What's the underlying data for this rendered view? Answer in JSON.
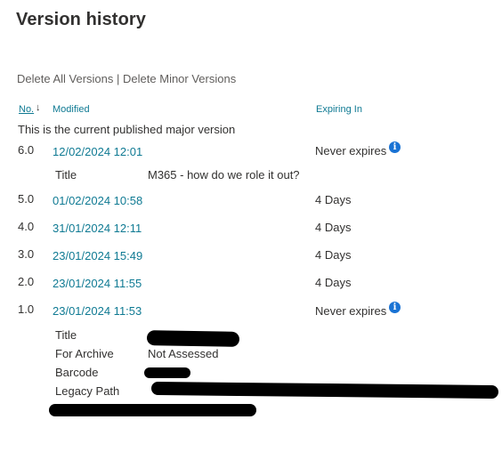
{
  "page": {
    "title": "Version history"
  },
  "actions": {
    "delete_all": "Delete All Versions",
    "separator": "|",
    "delete_minor": "Delete Minor Versions"
  },
  "columns": {
    "no": "No.",
    "sort_indicator": "↓",
    "modified": "Modified",
    "expiring": "Expiring In"
  },
  "current_note": "This is the current published major version",
  "versions": [
    {
      "no": "6.0",
      "modified": "12/02/2024 12:01",
      "expiring": "Never expires",
      "info_icon": "info-icon",
      "props": [
        {
          "label": "Title",
          "value": "M365 - how do we role it out?"
        }
      ]
    },
    {
      "no": "5.0",
      "modified": "01/02/2024 10:58",
      "expiring": "4 Days"
    },
    {
      "no": "4.0",
      "modified": "31/01/2024 12:11",
      "expiring": "4 Days"
    },
    {
      "no": "3.0",
      "modified": "23/01/2024 15:49",
      "expiring": "4 Days"
    },
    {
      "no": "2.0",
      "modified": "23/01/2024 11:55",
      "expiring": "4 Days"
    },
    {
      "no": "1.0",
      "modified": "23/01/2024 11:53",
      "expiring": "Never expires",
      "info_icon": "info-icon",
      "props": [
        {
          "label": "Title",
          "value": ""
        },
        {
          "label": "For Archive",
          "value": "Not Assessed"
        },
        {
          "label": "Barcode",
          "value": ""
        },
        {
          "label": "Legacy Path",
          "value": ""
        }
      ]
    }
  ],
  "colors": {
    "link": "#0f7a93",
    "text": "#323130",
    "muted": "#605e5c",
    "info": "#1a73d4"
  }
}
